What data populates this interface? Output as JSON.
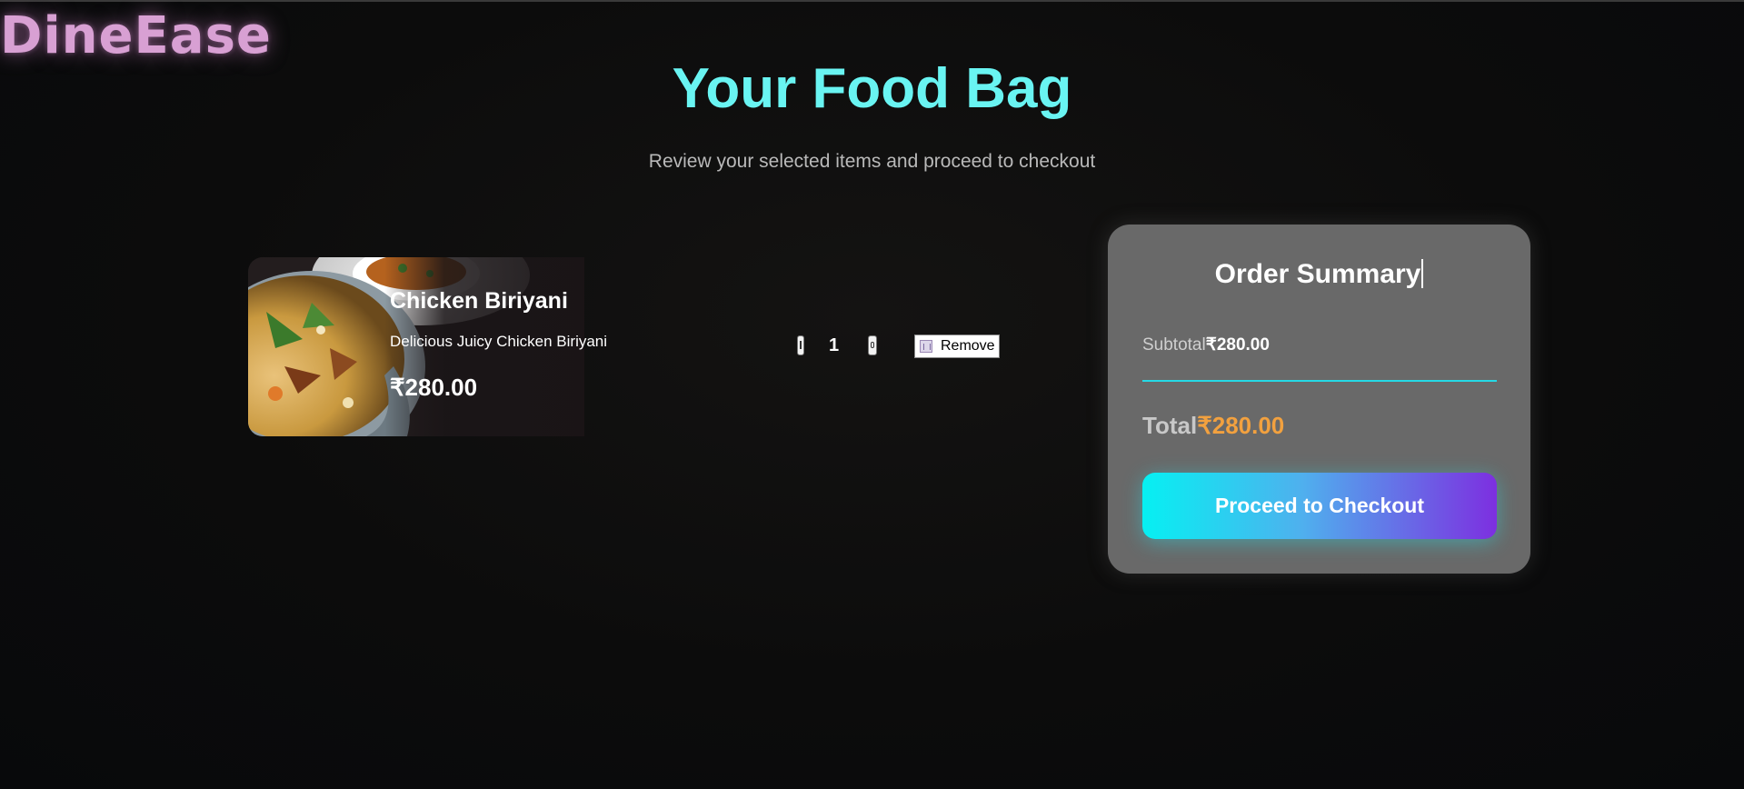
{
  "brand": {
    "logo_text": "DineEase"
  },
  "header": {
    "title": "Your Food Bag",
    "subtitle": "Review your selected items and proceed to checkout"
  },
  "cart": {
    "items": [
      {
        "name": "Chicken Biriyani",
        "description": "Delicious Juicy Chicken Biriyani",
        "price": "₹280.00",
        "quantity": "1",
        "remove_label": "Remove",
        "image_icon": "biriyani-photo"
      }
    ]
  },
  "summary": {
    "title": "Order Summary",
    "subtotal_label": "Subtotal",
    "subtotal_value": "₹280.00",
    "total_label": "Total",
    "total_value": "₹280.00",
    "checkout_label": "Proceed to Checkout"
  },
  "colors": {
    "title": "#69f4f2",
    "logo": "#d8a0d3",
    "total_value": "#f2a13f",
    "divider": "#25d9e6",
    "button_gradient_start": "#06f0f2",
    "button_gradient_end": "#7d2fe0",
    "card_bg": "#696969"
  }
}
